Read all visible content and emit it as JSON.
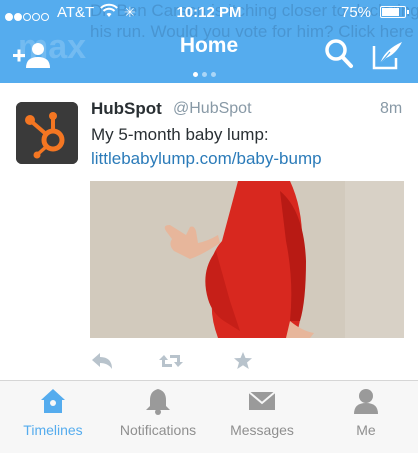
{
  "status_bar": {
    "carrier": "AT&T",
    "time": "10:12 PM",
    "battery": "75%",
    "battery_level": 0.75,
    "signal_bars": 2,
    "signal_total": 5
  },
  "header": {
    "title": "Home",
    "page_count": 3,
    "active_page": 0,
    "background_color": "#55acee",
    "behind_text": "Dr. Ben Carson is itching closer to declaring his run. Would you vote for him? Click here"
  },
  "tweet": {
    "author_name": "HubSpot",
    "author_handle": "@HubSpot",
    "time_ago": "8m",
    "text": "My 5-month baby lump:",
    "link": "littlebabylump.com/baby-bump",
    "link_color": "#2b7bb9",
    "avatar_icon": "hubspot-logo-icon",
    "avatar_color": "#f47622",
    "media_description_icon": "photo-icon",
    "actions": [
      "reply-icon",
      "retweet-icon",
      "favorite-icon"
    ]
  },
  "tabbar": {
    "active_color": "#55acee",
    "tabs": [
      {
        "label": "Timelines",
        "icon": "home-birdhouse-icon",
        "active": true
      },
      {
        "label": "Notifications",
        "icon": "bell-icon",
        "active": false
      },
      {
        "label": "Messages",
        "icon": "envelope-icon",
        "active": false
      },
      {
        "label": "Me",
        "icon": "person-icon",
        "active": false
      }
    ]
  }
}
